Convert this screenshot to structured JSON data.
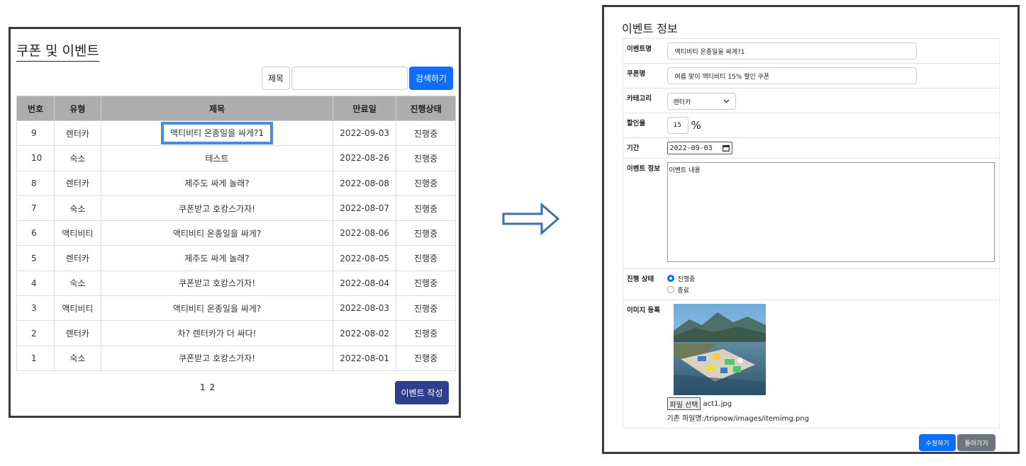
{
  "list_page": {
    "title": "쿠폰 및 이벤트",
    "search": {
      "label": "제목",
      "value": "",
      "button": "검색하기"
    },
    "columns": [
      "번호",
      "유형",
      "제목",
      "만료일",
      "진행상태"
    ],
    "rows": [
      [
        "9",
        "렌터카",
        "액티비티 온종일을 싸게?1",
        "2022-09-03",
        "진행중"
      ],
      [
        "10",
        "숙소",
        "테스트",
        "2022-08-26",
        "진행중"
      ],
      [
        "8",
        "렌터카",
        "제주도 싸게 놀래?",
        "2022-08-08",
        "진행중"
      ],
      [
        "7",
        "숙소",
        "쿠폰받고 호캉스가자!",
        "2022-08-07",
        "진행중"
      ],
      [
        "6",
        "액티비티",
        "액티비티 온종일을 싸게?",
        "2022-08-06",
        "진행중"
      ],
      [
        "5",
        "렌터카",
        "제주도 싸게 놀래?",
        "2022-08-05",
        "진행중"
      ],
      [
        "4",
        "숙소",
        "쿠폰받고 호캉스가자!",
        "2022-08-04",
        "진행중"
      ],
      [
        "3",
        "액티비티",
        "액티비티 온종일을 싸게?",
        "2022-08-03",
        "진행중"
      ],
      [
        "2",
        "렌터카",
        "차? 렌터카가 더 싸다!",
        "2022-08-02",
        "진행중"
      ],
      [
        "1",
        "숙소",
        "쿠폰받고 호캉스가자!",
        "2022-08-01",
        "진행중"
      ]
    ],
    "highlight_row": 0,
    "pagination": "1 2",
    "write_button": "이벤트 작성"
  },
  "detail_page": {
    "title": "이벤트 정보",
    "fields": {
      "event_name": {
        "label": "이벤트명",
        "value": "액티비티 온종일을 싸게?1"
      },
      "coupon_name": {
        "label": "쿠폰명",
        "value": "여름 맞이 액티비티 15% 할인 쿠폰"
      },
      "category": {
        "label": "카테고리",
        "value": "렌터카"
      },
      "discount": {
        "label": "할인율",
        "value": "15",
        "unit": "%"
      },
      "period": {
        "label": "기간",
        "value": "2022-09-03"
      },
      "info": {
        "label": "이벤트 정보",
        "value": "이벤트 내용"
      },
      "status": {
        "label": "진행 상태",
        "options": [
          "진행중",
          "종료"
        ],
        "selected": "진행중"
      },
      "image": {
        "label": "이미지 등록",
        "file_button": "파일 선택",
        "file_name": "act1.jpg",
        "existing": "기존 파일명:/tripnow/images/itemimg.png"
      }
    },
    "buttons": {
      "save": "수정하기",
      "back": "돌아가기"
    }
  },
  "colors": {
    "primary": "#0d6efd",
    "write_button": "#2f3f8f",
    "header_gray": "#adadad",
    "highlight": "#4a8fd3",
    "arrow": "#3d6fa8"
  }
}
